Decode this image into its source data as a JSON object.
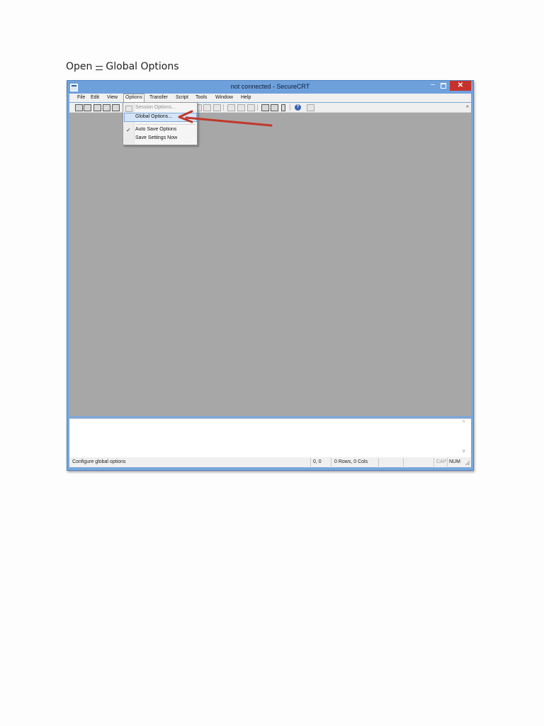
{
  "caption": {
    "text_before": "Open",
    "text_after": "Global Options"
  },
  "window": {
    "title": "not connected - SecureCRT",
    "min_glyph": "–",
    "close_glyph": "✕"
  },
  "menu": [
    "File",
    "Edit",
    "View",
    "Options",
    "Transfer",
    "Script",
    "Tools",
    "Window",
    "Help"
  ],
  "options_menu": {
    "session_options": "Session Options...",
    "global_options": "Global Options...",
    "auto_save": "Auto Save Options",
    "save_settings": "Save Settings Now",
    "check_glyph": "✓",
    "auto_save_checked": true
  },
  "toolbar": {
    "help_glyph": "?",
    "more_glyph": "»"
  },
  "lower_pane": {
    "scroll_up": "^",
    "scroll_down": "v"
  },
  "statusbar": {
    "message": "Configure global options",
    "position": "0, 0",
    "size": "0 Rows, 0 Cols",
    "cap": "CAP",
    "num": "NUM"
  },
  "colors": {
    "annotation_arrow": "#c0392b",
    "close_button": "#c7312b",
    "title_bar": "#6ea0dc",
    "workspace": "#a7a7a7"
  }
}
